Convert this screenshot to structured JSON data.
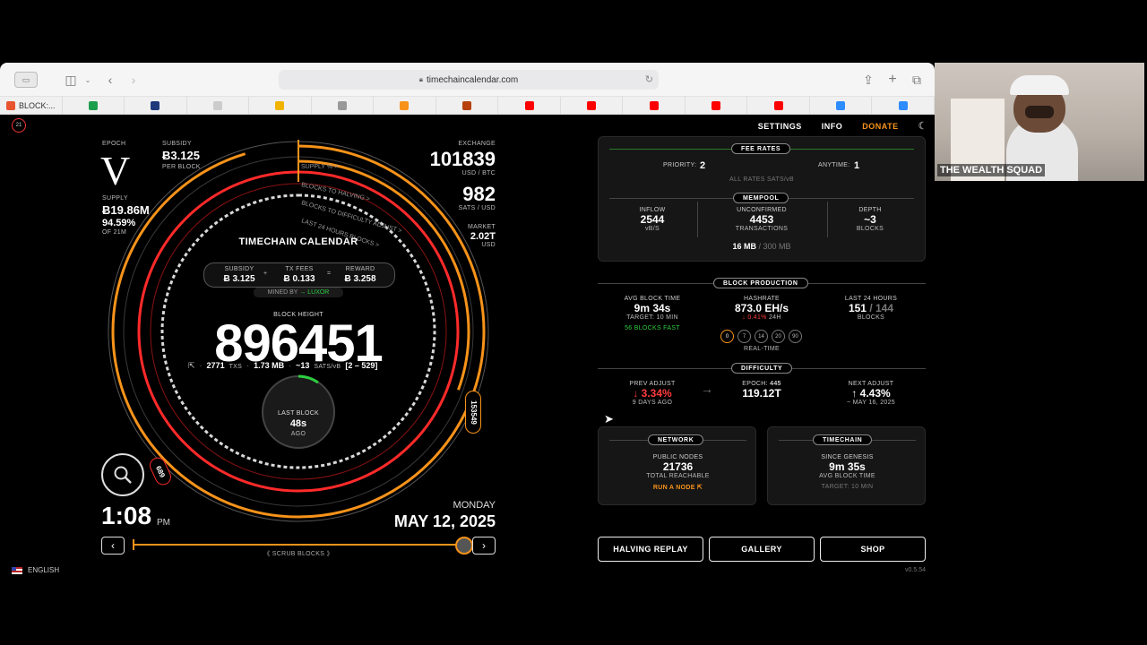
{
  "browser": {
    "url": "timechaincalendar.com",
    "tabs": [
      {
        "label": "BLOCK:...",
        "color": "#e8542e"
      },
      {
        "label": "",
        "color": "#1b9e4b"
      },
      {
        "label": "",
        "color": "#1e3a7b"
      },
      {
        "label": "",
        "color": "#cccccc"
      },
      {
        "label": "",
        "color": "#f0b400"
      },
      {
        "label": "",
        "color": "#999999"
      },
      {
        "label": "",
        "color": "#f7931a"
      },
      {
        "label": "",
        "color": "#b7410e"
      },
      {
        "label": "",
        "color": "#ff0000"
      },
      {
        "label": "",
        "color": "#ff0000"
      },
      {
        "label": "",
        "color": "#ff0000"
      },
      {
        "label": "",
        "color": "#ff0000"
      },
      {
        "label": "",
        "color": "#ff0000"
      },
      {
        "label": "",
        "color": "#2d8cff"
      },
      {
        "label": "",
        "color": "#2d8cff"
      }
    ]
  },
  "nav": {
    "settings": "SETTINGS",
    "info": "INFO",
    "donate": "DONATE",
    "moon_icon": "☾"
  },
  "dial": {
    "epoch_label": "EPOCH",
    "epoch_value": "V",
    "subsidy_label": "SUBSIDY",
    "subsidy_value": "Ƀ3.125",
    "per_block": "PER BLOCK",
    "supply_label": "SUPPLY",
    "supply_value": "Ƀ19.86M",
    "supply_pct": "94.59%",
    "of_21m": "OF 21M",
    "exchange_label": "EXCHANGE",
    "exchange_value": "101839",
    "usd_btc": "USD / BTC",
    "sats_value": "982",
    "sats_usd": "SATS / USD",
    "market_label": "MARKET",
    "market_value": "2.02T",
    "market_unit": "USD",
    "ring_supply": "SUPPLY % >",
    "ring_halving": "BLOCKS TO HALVING >",
    "ring_diff": "BLOCKS TO DIFFICULTY ADJUST >",
    "ring_last24": "LAST 24 HOURS BLOCKS >",
    "title": "TIMECHAIN CALENDAR",
    "subsidy_small_label": "SUBSIDY",
    "subsidy_small_value": "Ƀ 3.125",
    "plus": "+",
    "txfees_label": "TX FEES",
    "txfees_value": "Ƀ 0.133",
    "equals": "=",
    "reward_label": "REWARD",
    "reward_value": "Ƀ 3.258",
    "mined_by": "MINED BY",
    "miner": "→ LUXOR",
    "block_height_label": "BLOCK HEIGHT",
    "block_height": "896451",
    "txs": "2771",
    "txs_label": "TXS",
    "size": "1.73 MB",
    "feerate": "~13",
    "feerate_unit": "SATS/vB",
    "feerange": "[2 – 529]",
    "last_block_label": "LAST BLOCK",
    "last_block_value": "48s",
    "ago": "AGO",
    "halving_badge": "153549",
    "diff_badge": "689",
    "time": "1:08",
    "ampm": "PM",
    "weekday": "MONDAY",
    "date": "MAY 12, 2025",
    "scrub": "《 SCRUB BLOCKS 》",
    "language": "ENGLISH"
  },
  "fee_rates": {
    "tag": "FEE RATES",
    "priority_label": "PRIORITY:",
    "priority_value": "2",
    "anytime_label": "ANYTIME:",
    "anytime_value": "1",
    "note": "ALL RATES SATS/vB"
  },
  "mempool": {
    "tag": "MEMPOOL",
    "inflow_label": "INFLOW",
    "inflow_value": "2544",
    "inflow_unit": "vB/S",
    "unconfirmed_label": "UNCONFIRMED",
    "unconfirmed_value": "4453",
    "unconfirmed_unit": "TRANSACTIONS",
    "depth_label": "DEPTH",
    "depth_value": "~3",
    "depth_unit": "BLOCKS",
    "size_used": "16 MB",
    "size_total": "/ 300 MB"
  },
  "block_production": {
    "tag": "BLOCK PRODUCTION",
    "avg_label": "AVG BLOCK TIME",
    "avg_value": "9m 34s",
    "avg_target": "TARGET: 10 MIN",
    "blocks_fast": "56 BLOCKS FAST",
    "hash_label": "HASHRATE",
    "hash_value": "873.0 EH/s",
    "hash_change": "↓ 0.41%",
    "hash_period": "24H",
    "hash_windows": [
      "0",
      "7",
      "14",
      "20",
      "90"
    ],
    "realtime": "REAL-TIME",
    "last24_label": "LAST 24 HOURS",
    "last24_value": "151",
    "last24_total": "/ 144",
    "last24_unit": "BLOCKS"
  },
  "difficulty": {
    "tag": "DIFFICULTY",
    "prev_label": "PREV ADJUST",
    "prev_value": "↓ 3.34%",
    "prev_ago": "9 DAYS AGO",
    "arrow": "→",
    "epoch_label": "EPOCH:",
    "epoch_value": "445",
    "epoch_diff": "119.12T",
    "next_label": "NEXT ADJUST",
    "next_value": "↑ 4.43%",
    "next_date": "~ MAY 16, 2025"
  },
  "network": {
    "tag": "NETWORK",
    "nodes_label": "PUBLIC NODES",
    "nodes_value": "21736",
    "reachable": "TOTAL REACHABLE",
    "run_node": "RUN A NODE"
  },
  "timechain": {
    "tag": "TIMECHAIN",
    "since_label": "SINCE GENESIS",
    "since_value": "9m 35s",
    "avg_label": "AVG BLOCK TIME",
    "target": "TARGET: 10 MIN"
  },
  "buttons": {
    "halving": "HALVING REPLAY",
    "gallery": "GALLERY",
    "shop": "SHOP"
  },
  "version": "v0.5.54",
  "webcam": {
    "name": "THE WEALTH SQUAD"
  },
  "colors": {
    "accent": "#f7931a",
    "red": "#ff2a2a",
    "green": "#2ecc40"
  }
}
